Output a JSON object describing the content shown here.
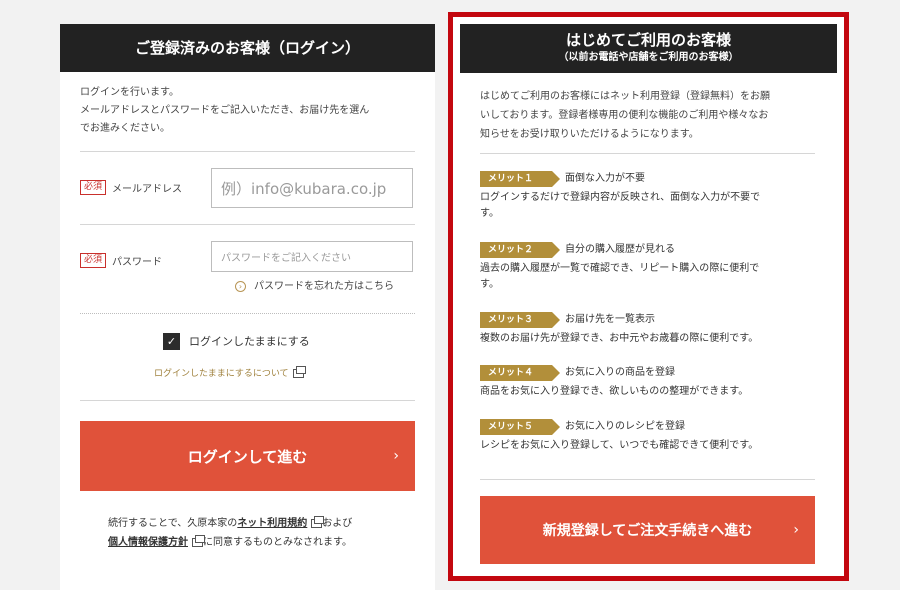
{
  "login": {
    "heading": "ご登録済みのお客様（ログイン）",
    "intro_line1": "ログインを行います。",
    "intro_line2": "メールアドレスとパスワードをご記入いただき、お届け先を選ん",
    "intro_line3": "でお進みください。",
    "required_badge": "必須",
    "email_label": "メールアドレス",
    "email_placeholder": "例）info@kubara.co.jp",
    "password_label": "パスワード",
    "password_placeholder": "パスワードをご記入ください",
    "forgot_link": "パスワードを忘れた方はこちら",
    "remember_label": "ログインしたままにする",
    "remember_checked": true,
    "remember_about_link": "ログインしたままにするについて",
    "submit_button": "ログインして進む",
    "terms_prefix": "続行することで、久原本家の",
    "terms_link": "ネット利用規約",
    "terms_mid": "および",
    "privacy_link": "個人情報保護方針",
    "terms_suffix": "に同意するものとみなされます。"
  },
  "signup": {
    "heading": "はじめてご利用のお客様",
    "subheading": "（以前お電話や店舗をご利用のお客様）",
    "intro_line1": "はじめてご利用のお客様にはネット利用登録（登録無料）をお願",
    "intro_line2": "いしております。登録者様専用の便利な機能のご利用や様々なお",
    "intro_line3": "知らせをお受け取りいただけるようになります。",
    "merits": [
      {
        "tag": "メリット１",
        "title": "面倒な入力が不要",
        "desc1": "ログインするだけで登録内容が反映され、面倒な入力が不要で",
        "desc2": "す。"
      },
      {
        "tag": "メリット２",
        "title": "自分の購入履歴が見れる",
        "desc1": "過去の購入履歴が一覧で確認でき、リピート購入の際に便利で",
        "desc2": "す。"
      },
      {
        "tag": "メリット３",
        "title": "お届け先を一覧表示",
        "desc1": "複数のお届け先が登録でき、お中元やお歳暮の際に便利です。",
        "desc2": ""
      },
      {
        "tag": "メリット４",
        "title": "お気に入りの商品を登録",
        "desc1": "商品をお気に入り登録でき、欲しいものの整理ができます。",
        "desc2": ""
      },
      {
        "tag": "メリット５",
        "title": "お気に入りのレシピを登録",
        "desc1": "レシピをお気に入り登録して、いつでも確認できて便利です。",
        "desc2": ""
      }
    ],
    "submit_button": "新規登録してご注文手続きへ進む"
  },
  "colors": {
    "button": "#e0523a",
    "header": "#222222",
    "highlight_border": "#c3070f",
    "merit_tag": "#b28f3a"
  }
}
